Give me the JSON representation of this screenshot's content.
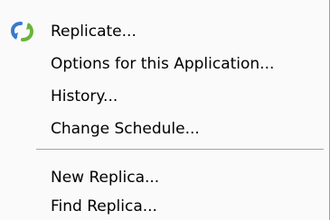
{
  "menu": {
    "items": [
      {
        "label": "Replicate...",
        "icon": "replicate-icon"
      },
      {
        "label": "Options for this Application..."
      },
      {
        "label": "History..."
      },
      {
        "label": "Change Schedule..."
      },
      {
        "label": "New Replica..."
      },
      {
        "label": "Find Replica..."
      }
    ]
  },
  "colors": {
    "menu_background": "#fafafa",
    "separator": "#a3a3a3",
    "icon_blue": "#3a78c8",
    "icon_green": "#6ab43a"
  }
}
